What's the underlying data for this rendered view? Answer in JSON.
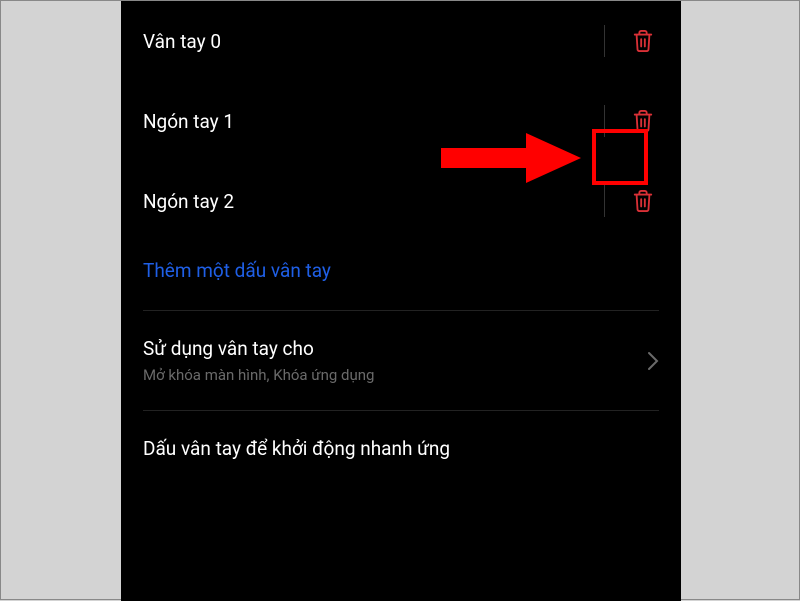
{
  "fingerprints": [
    {
      "label": "Vân tay 0",
      "key": "fp0"
    },
    {
      "label": "Ngón tay 1",
      "key": "fp1"
    },
    {
      "label": "Ngón tay 2",
      "key": "fp2"
    }
  ],
  "add_link_label": "Thêm một dấu vân tay",
  "nav": {
    "use_for": {
      "title": "Sử dụng vân tay cho",
      "subtitle": "Mở khóa màn hình, Khóa ứng dụng"
    },
    "quick_launch_title": "Dấu vân tay để khởi động nhanh ứng"
  },
  "colors": {
    "accent_red": "#d93036",
    "link_blue": "#1f5fe6",
    "highlight_red": "#ff0000"
  },
  "annotation": {
    "highlighted_item_index": 1
  }
}
